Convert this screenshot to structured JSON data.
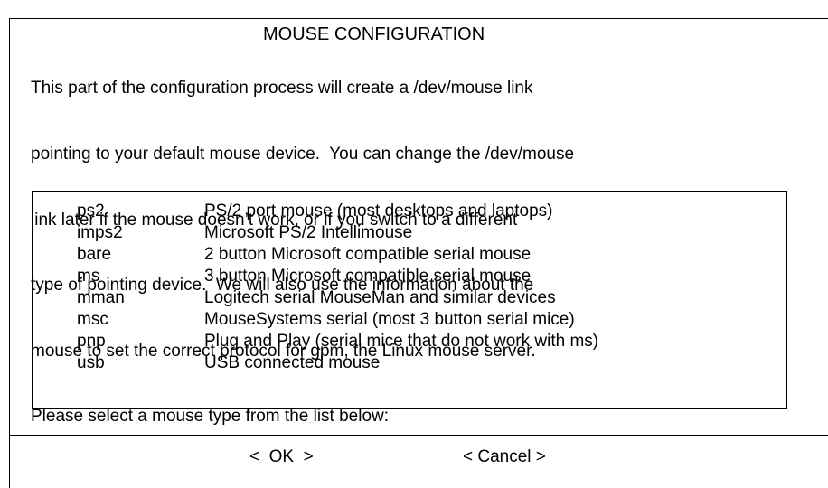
{
  "dialog": {
    "title": "MOUSE CONFIGURATION",
    "description_lines": [
      "This part of the configuration process will create a /dev/mouse link",
      "pointing to your default mouse device.  You can change the /dev/mouse",
      "link later if the mouse doesn’t work, or if you switch to a different",
      "type of pointing device.  We will also use the information about the",
      "mouse to set the correct protocol for gpm, the Linux mouse server.",
      "Please select a mouse type from the list below:"
    ]
  },
  "list": {
    "items": [
      {
        "code": "ps2",
        "description": "PS/2 port mouse (most desktops and laptops)"
      },
      {
        "code": "imps2",
        "description": "Microsoft PS/2 Intellimouse"
      },
      {
        "code": "bare",
        "description": "2 button Microsoft compatible serial mouse"
      },
      {
        "code": "ms",
        "description": "3 button Microsoft compatible serial mouse"
      },
      {
        "code": "mman",
        "description": "Logitech serial MouseMan and similar devices"
      },
      {
        "code": "msc",
        "description": "MouseSystems serial (most 3 button serial mice)"
      },
      {
        "code": "pnp",
        "description": "Plug and Play (serial mice that do not work with ms)"
      },
      {
        "code": "usb",
        "description": "USB connected mouse"
      }
    ]
  },
  "buttons": {
    "ok_label": "<  OK  >",
    "cancel_label": "< Cancel >"
  }
}
